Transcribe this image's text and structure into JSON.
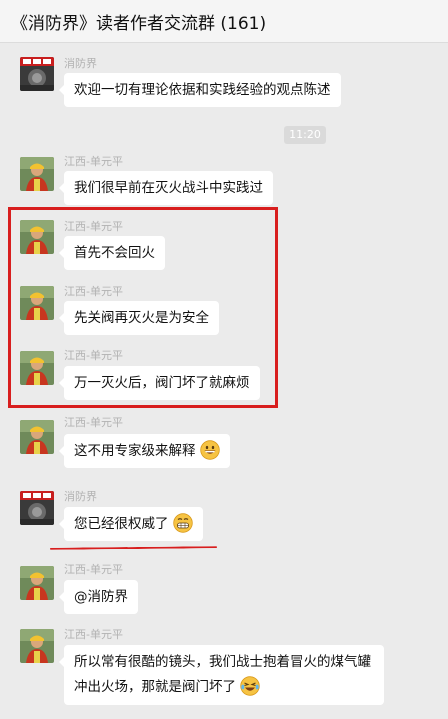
{
  "header": {
    "title": "《消防界》读者作者交流群 (161)"
  },
  "timestamp": "11:20",
  "colors": {
    "background": "#ebebeb",
    "bubble": "#ffffff",
    "highlight": "#d81e1e",
    "sender_name": "#b2b2b2"
  },
  "avatars": {
    "fire_brand": "fire-brigade-logo-avatar",
    "jiangxi": "firefighter-photo-avatar"
  },
  "messages": [
    {
      "sender": "消防界",
      "text": "欢迎一切有理论依据和实践经验的观点陈述"
    },
    {
      "sender": "江西-单元平",
      "text": "我们很早前在灭火战斗中实践过"
    },
    {
      "sender": "江西-单元平",
      "text": "首先不会回火"
    },
    {
      "sender": "江西-单元平",
      "text": "先关阀再灭火是为安全"
    },
    {
      "sender": "江西-单元平",
      "text": "万一灭火后，阀门坏了就麻烦"
    },
    {
      "sender": "江西-单元平",
      "text": "这不用专家级来解释",
      "emoji": "grinning-emoji"
    },
    {
      "sender": "消防界",
      "text": "您已经很权威了",
      "emoji": "grinning-teeth-emoji"
    },
    {
      "sender": "江西-单元平",
      "text": "@消防界"
    },
    {
      "sender": "江西-单元平",
      "text": "所以常有很酷的镜头，我们战士抱着冒火的煤气罐冲出火场，那就是阀门坏了",
      "emoji": "laughing-tears-emoji"
    }
  ]
}
